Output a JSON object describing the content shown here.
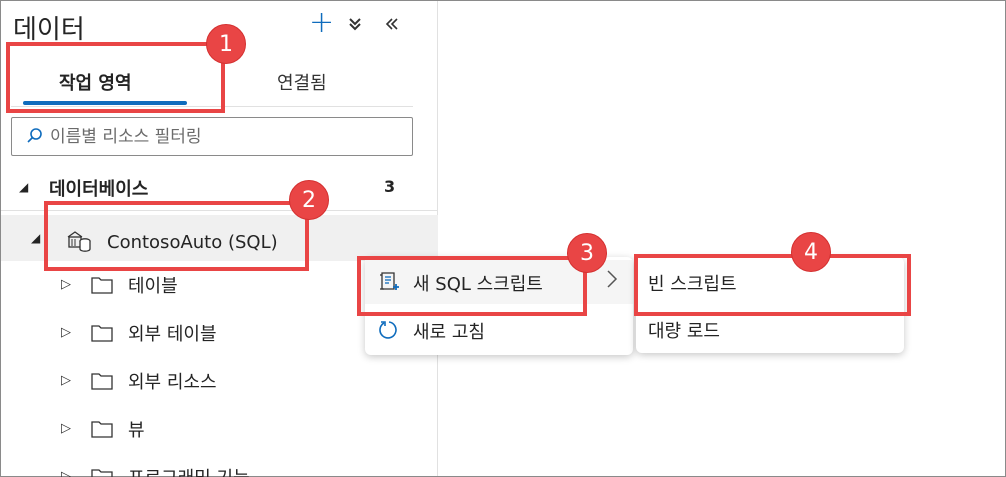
{
  "panel": {
    "title": "데이터",
    "actions": {
      "add_icon": "plus-icon",
      "collapse_icon": "double-chevron-down-icon",
      "hide_icon": "double-chevron-left-icon"
    },
    "tabs": [
      {
        "label": "작업 영역",
        "selected": true
      },
      {
        "label": "연결됨",
        "selected": false
      }
    ],
    "search": {
      "placeholder": "이름별 리소스 필터링",
      "value": ""
    }
  },
  "tree": {
    "section": {
      "label": "데이터베이스",
      "count": "3"
    },
    "database": {
      "label": "ContosoAuto (SQL)",
      "icon": "sql-database-icon"
    },
    "children": [
      {
        "label": "테이블"
      },
      {
        "label": "외부 테이블"
      },
      {
        "label": "외부 리소스"
      },
      {
        "label": "뷰"
      },
      {
        "label": "프로그래밍 기능"
      }
    ]
  },
  "context_menu": {
    "items": [
      {
        "label": "새 SQL 스크립트",
        "icon": "sql-script-icon",
        "has_submenu": true
      },
      {
        "label": "새로 고침",
        "icon": "refresh-icon"
      }
    ]
  },
  "submenu": {
    "items": [
      {
        "label": "빈 스크립트"
      },
      {
        "label": "대량 로드"
      }
    ]
  },
  "callouts": [
    "1",
    "2",
    "3",
    "4"
  ],
  "colors": {
    "accent": "#0f6cbd",
    "callout": "#e94545",
    "row_selected": "#f0f0f0"
  }
}
